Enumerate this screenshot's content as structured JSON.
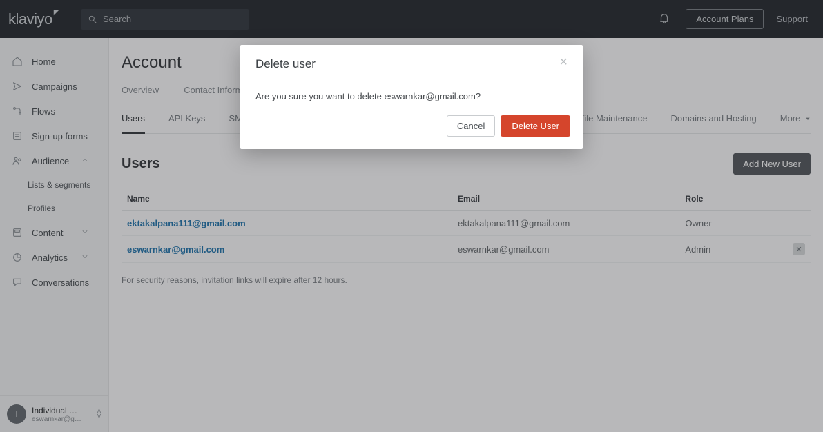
{
  "header": {
    "logo": "klaviyo",
    "search_placeholder": "Search",
    "account_plans_label": "Account Plans",
    "support_label": "Support"
  },
  "sidebar": {
    "items": [
      {
        "label": "Home",
        "icon": "home-icon"
      },
      {
        "label": "Campaigns",
        "icon": "campaigns-icon"
      },
      {
        "label": "Flows",
        "icon": "flows-icon"
      },
      {
        "label": "Sign-up forms",
        "icon": "forms-icon"
      },
      {
        "label": "Audience",
        "icon": "audience-icon",
        "expanded": true
      },
      {
        "label": "Content",
        "icon": "content-icon",
        "collapsed": true
      },
      {
        "label": "Analytics",
        "icon": "analytics-icon",
        "collapsed": true
      },
      {
        "label": "Conversations",
        "icon": "conversations-icon"
      }
    ],
    "audience_children": [
      {
        "label": "Lists & segments"
      },
      {
        "label": "Profiles"
      }
    ],
    "account": {
      "avatar_letter": "I",
      "name": "Individual …",
      "email": "eswarnkar@g…"
    }
  },
  "page": {
    "title": "Account",
    "primary_tabs": [
      "Overview",
      "Contact Information"
    ],
    "settings_tabs": [
      "Users",
      "API Keys",
      "SMS"
    ],
    "right_tabs": [
      "file Maintenance",
      "Domains and Hosting"
    ],
    "more_label": "More",
    "users_section": {
      "title": "Users",
      "add_button": "Add New User",
      "columns": [
        "Name",
        "Email",
        "Role"
      ],
      "rows": [
        {
          "name": "ektakalpana111@gmail.com",
          "email": "ektakalpana111@gmail.com",
          "role": "Owner",
          "deletable": false
        },
        {
          "name": "eswarnkar@gmail.com",
          "email": "eswarnkar@gmail.com",
          "role": "Admin",
          "deletable": true
        }
      ],
      "footnote": "For security reasons, invitation links will expire after 12 hours."
    }
  },
  "modal": {
    "title": "Delete user",
    "body": "Are you sure you want to delete eswarnkar@gmail.com?",
    "cancel_label": "Cancel",
    "confirm_label": "Delete User"
  }
}
